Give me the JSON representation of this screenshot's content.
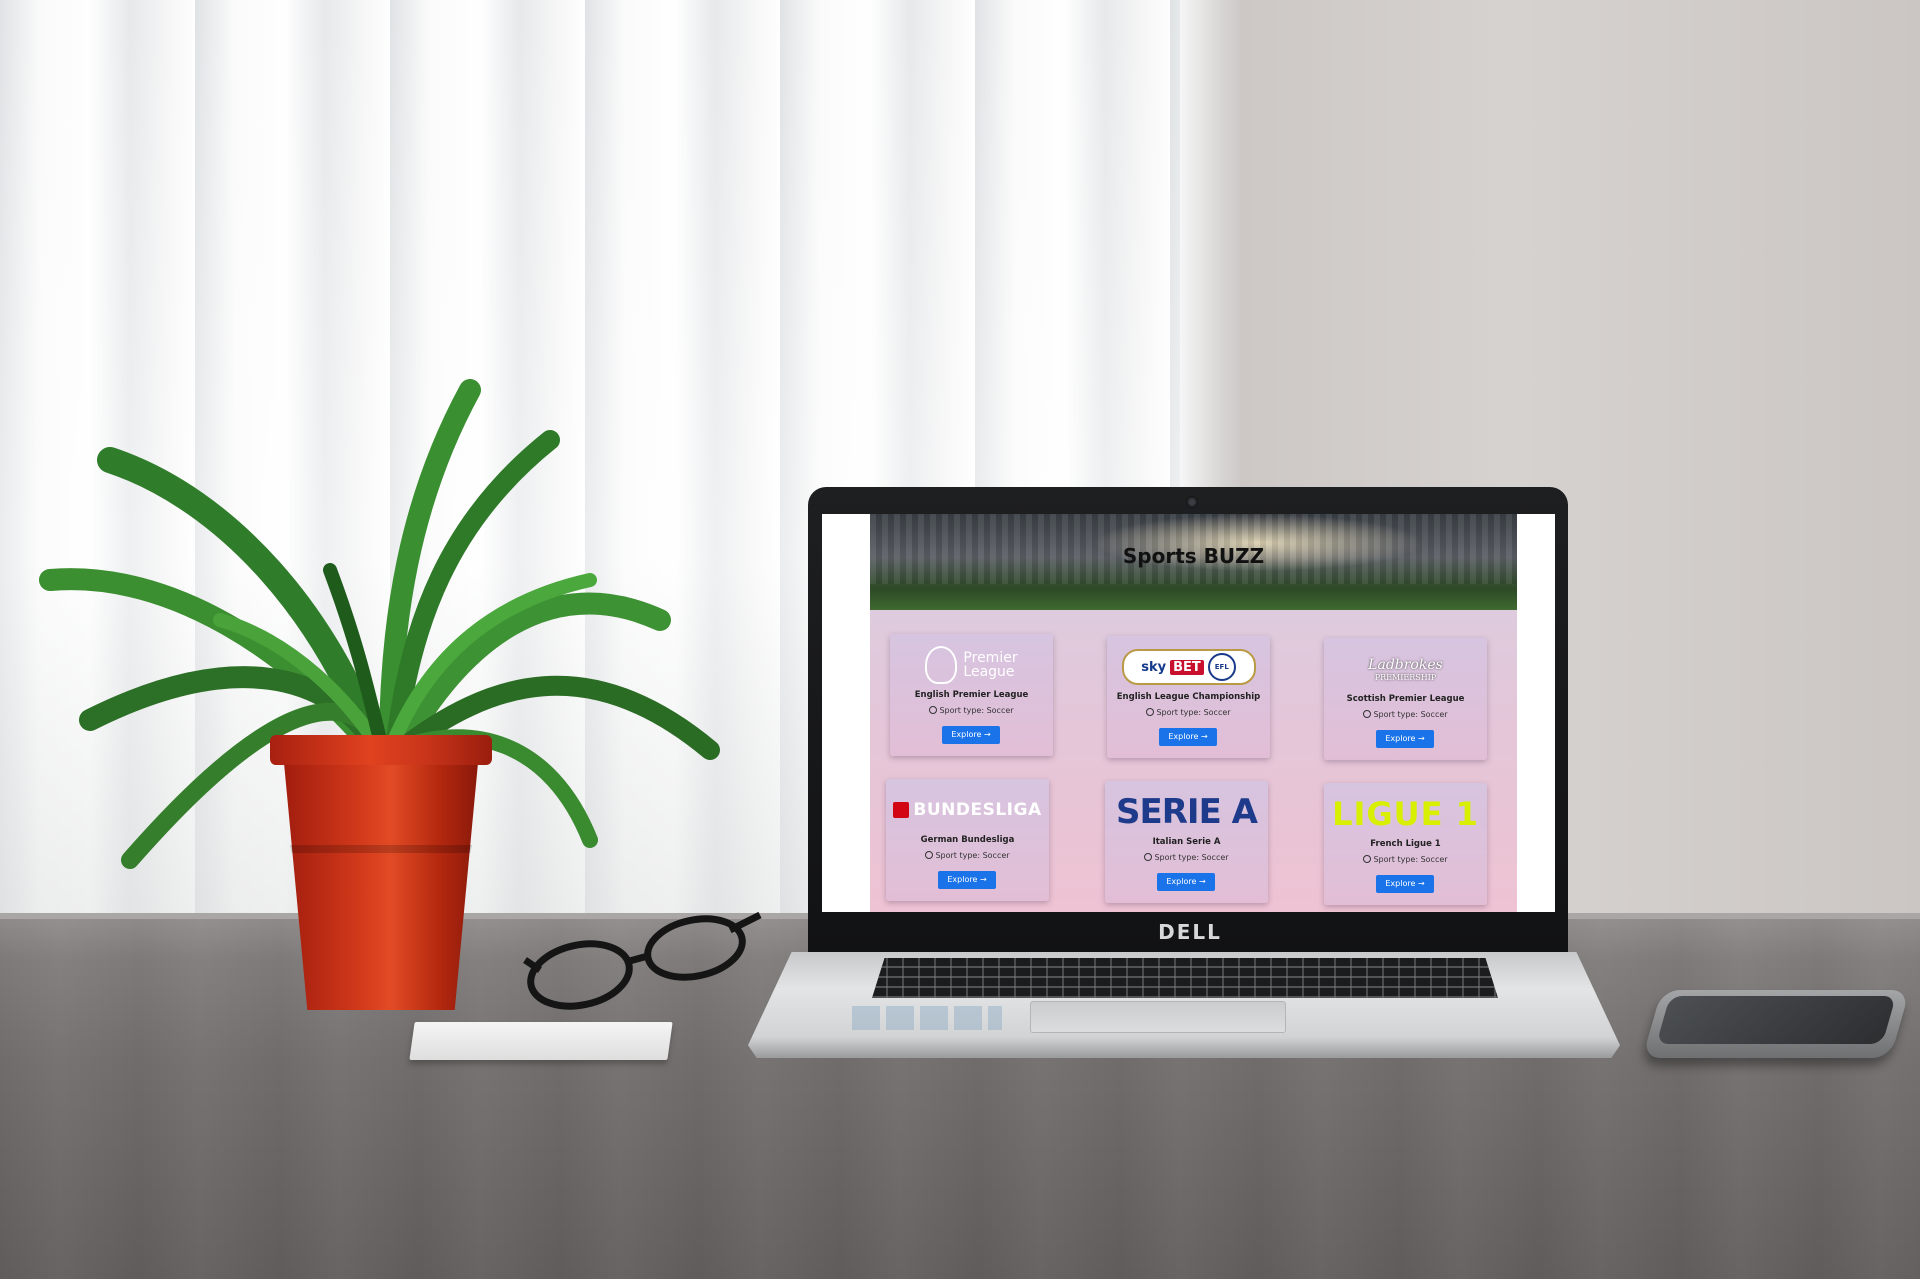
{
  "site": {
    "title": "Sports BUZZ",
    "accent_color": "#1a73e8"
  },
  "laptop": {
    "brand": "DELL"
  },
  "leagues": [
    {
      "logo_text_1": "Premier",
      "logo_text_2": "League",
      "name": "English Premier League",
      "sport": "Sport type: Soccer",
      "button": "Explore"
    },
    {
      "logo_text_1": "sky",
      "logo_text_2": "BET",
      "logo_text_3": "CHAMPIONSHIP",
      "logo_text_4": "EFL",
      "name": "English League Championship",
      "sport": "Sport type: Soccer",
      "button": "Explore"
    },
    {
      "logo_text_1": "Ladbrokes",
      "logo_text_2": "PREMIERSHIP",
      "name": "Scottish Premier League",
      "sport": "Sport type: Soccer",
      "button": "Explore"
    },
    {
      "logo_text_1": "BUNDESLIGA",
      "name": "German Bundesliga",
      "sport": "Sport type: Soccer",
      "button": "Explore"
    },
    {
      "logo_text_1": "SERIE A",
      "name": "Italian Serie A",
      "sport": "Sport type: Soccer",
      "button": "Explore"
    },
    {
      "logo_text_1": "LIGUE 1",
      "name": "French Ligue 1",
      "sport": "Sport type: Soccer",
      "button": "Explore"
    }
  ],
  "icons": {
    "sport": "soccer-ball-icon",
    "button": "arrow-right-icon"
  }
}
